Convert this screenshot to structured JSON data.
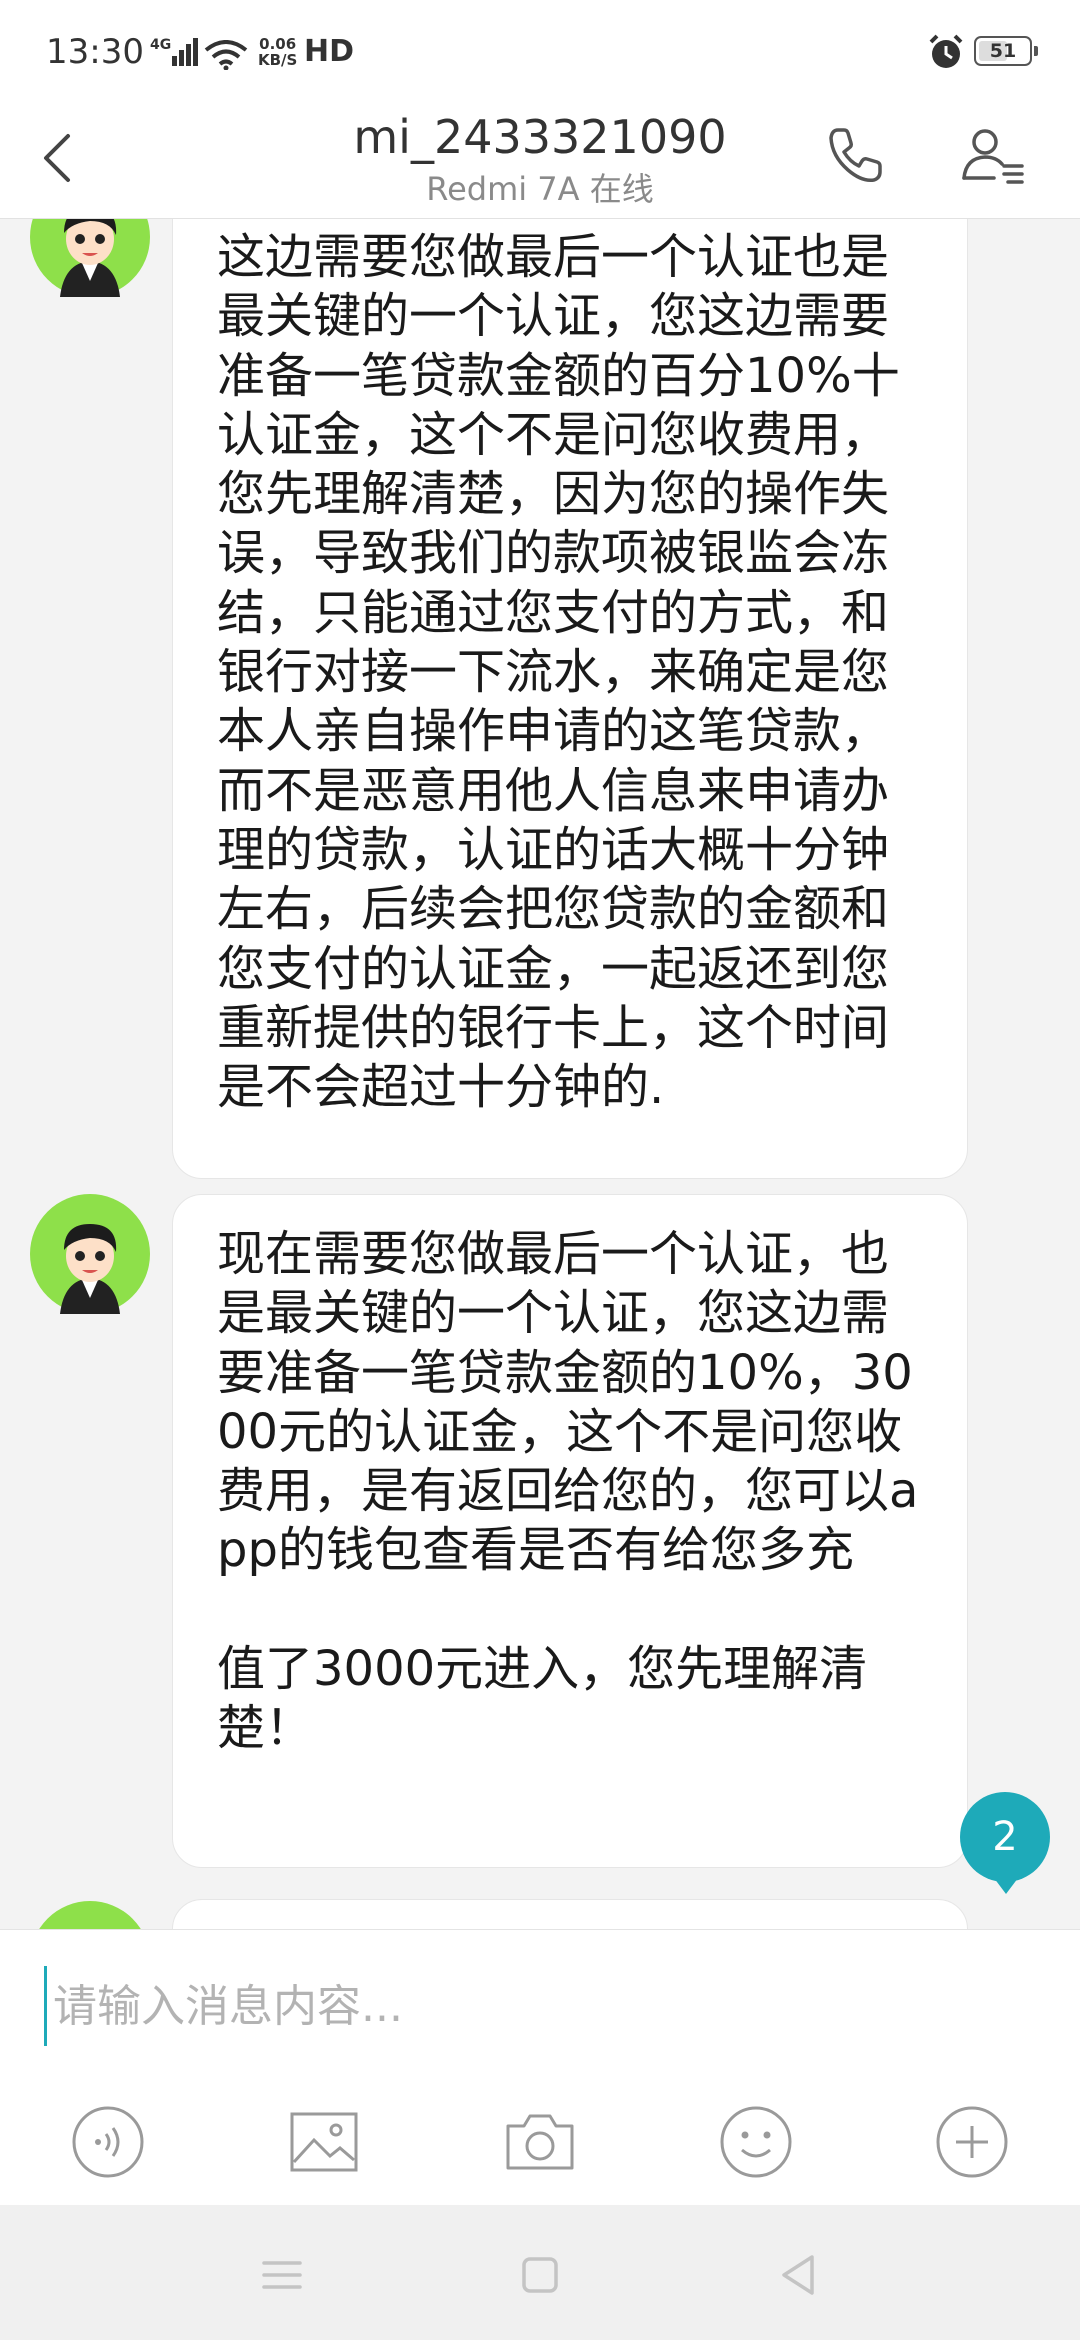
{
  "status_bar": {
    "time": "13:30",
    "network": "4G",
    "speed_value": "0.06",
    "speed_unit": "KB/S",
    "hd": "HD",
    "battery": "51"
  },
  "header": {
    "title": "mi_2433321090",
    "subtitle": "Redmi 7A 在线"
  },
  "messages": [
    {
      "text": "这边需要您做最后一个认证也是最关键的一个认证，您这边需要准备一笔贷款金额的百分10%十认证金，这个不是问您收费用，您先理解清楚，因为您的操作失误，导致我们的款项被银监会冻结，只能通过您支付的方式，和银行对接一下流水，来确定是您本人亲自操作申请的这笔贷款，而不是恶意用他人信息来申请办理的贷款，认证的话大概十分钟左右，后续会把您贷款的金额和您支付的认证金，一起返还到您重新提供的银行卡上，这个时间是不会超过十分钟的."
    },
    {
      "text": "现在需要您做最后一个认证，也是最关键的一个认证，您这边需要准备一笔贷款金额的10%，3000元的认证金，这个不是问您收费用，是有返回给您的，您可以app的钱包查看是否有给您多充\n\n值了3000元进入，您先理解清楚！"
    },
    {
      "text": ""
    }
  ],
  "unread_count": "2",
  "composer": {
    "placeholder": "请输入消息内容...",
    "value": ""
  },
  "toolbar_icons": [
    "voice-icon",
    "image-icon",
    "camera-icon",
    "emoji-icon",
    "add-icon"
  ],
  "nav_icons": [
    "menu-icon",
    "home-icon",
    "back-icon"
  ],
  "colors": {
    "accent": "#1eaab9",
    "avatar_bg": "#8ee04a",
    "page_bg": "#f3f3f3"
  }
}
